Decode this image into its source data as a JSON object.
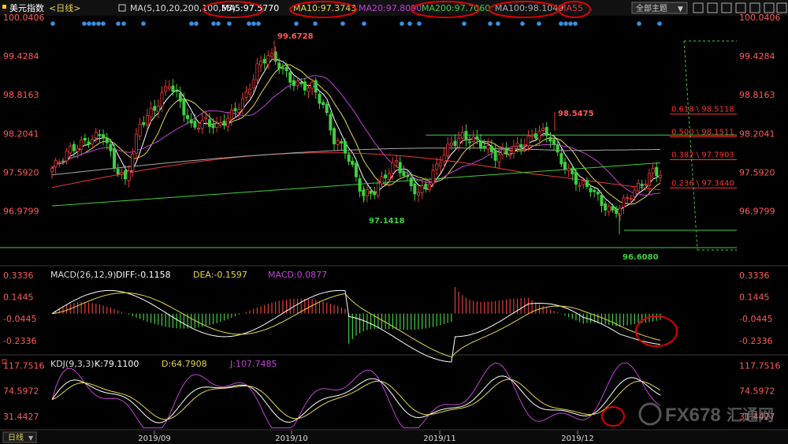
{
  "header": {
    "instrument": "美元指数",
    "period_tag": "<日线>",
    "theme_selector": "全部主题",
    "ma_items": [
      {
        "text": "MA(5,10,20,200,100,55)",
        "color": "#d9d9d9"
      },
      {
        "text": "MA5:97.5770",
        "color": "#ffffff"
      },
      {
        "text": "MA10:97.3743",
        "color": "#e6d84a"
      },
      {
        "text": "MA20:97.8090",
        "color": "#c341d6"
      },
      {
        "text": "MA200:97.7060",
        "color": "#3ecf3e"
      },
      {
        "text": "MA100:98.1049",
        "color": "#a8a8a8"
      },
      {
        "text": "MA55",
        "color": "#e83a3a"
      }
    ]
  },
  "price_panel": {
    "y_ticks": [
      "100.0406",
      "99.4284",
      "98.8163",
      "98.2041",
      "97.5920",
      "96.9799"
    ],
    "annotations": {
      "high": "99.6728",
      "low1": "97.1418",
      "high2": "98.5475",
      "low2": "96.6080"
    },
    "fib_levels": [
      {
        "label": "0.618 \\ 98.5118",
        "value": 98.5118
      },
      {
        "label": "0.500 \\ 98.1511",
        "value": 98.1511
      },
      {
        "label": "0.382 \\ 97.7903",
        "value": 97.7903
      },
      {
        "label": "0.236 \\ 97.3440",
        "value": 97.344
      }
    ]
  },
  "macd_panel": {
    "title": "MACD(26,12,9)",
    "diff": "DIFF:-0.1158",
    "dea": "DEA:-0.1597",
    "macd": "MACD:0.0877",
    "y_ticks": [
      "0.3336",
      "0.1445",
      "-0.0445",
      "-0.2336"
    ]
  },
  "kdj_panel": {
    "title": "KDJ(9,3,3)",
    "k": "K:79.1100",
    "d": "D:64.7908",
    "j": "J:107.7485",
    "y_ticks": [
      "117.7516",
      "74.5972",
      "31.4427"
    ]
  },
  "time_axis": {
    "period_button": "日线",
    "dates": [
      "2019/09",
      "2019/10",
      "2019/11",
      "2019/12"
    ]
  },
  "watermark": {
    "brand": "FX678",
    "cn": "汇通网"
  },
  "colors": {
    "up": "#e83a3a",
    "down": "#3ecf3e",
    "fib": "#ff3333",
    "circle": "#e00000",
    "macd_diff": "#ffffff",
    "macd_dea": "#e6d84a",
    "k": "#ffffff",
    "d": "#e6d84a",
    "j": "#c341d6"
  },
  "chart_data": {
    "type": "candlestick",
    "title": "美元指数 <日线>",
    "ylim": [
      96.35,
      100.0406
    ],
    "x_labels": [
      "2019/09",
      "2019/10",
      "2019/11",
      "2019/12"
    ],
    "key_points": [
      {
        "label": "high",
        "value": 99.6728,
        "period": "2019/10"
      },
      {
        "label": "low",
        "value": 97.1418,
        "period": "2019/10"
      },
      {
        "label": "high",
        "value": 98.5475,
        "period": "2019/11"
      },
      {
        "label": "low",
        "value": 96.608,
        "period": "2019/12"
      }
    ],
    "macd": {
      "diff": -0.1158,
      "dea": -0.1597,
      "macd": 0.0877,
      "ylim": [
        -0.33,
        0.38
      ]
    },
    "kdj": {
      "k": 79.11,
      "d": 64.7908,
      "j": 107.7485,
      "ylim": [
        10,
        125
      ]
    }
  }
}
